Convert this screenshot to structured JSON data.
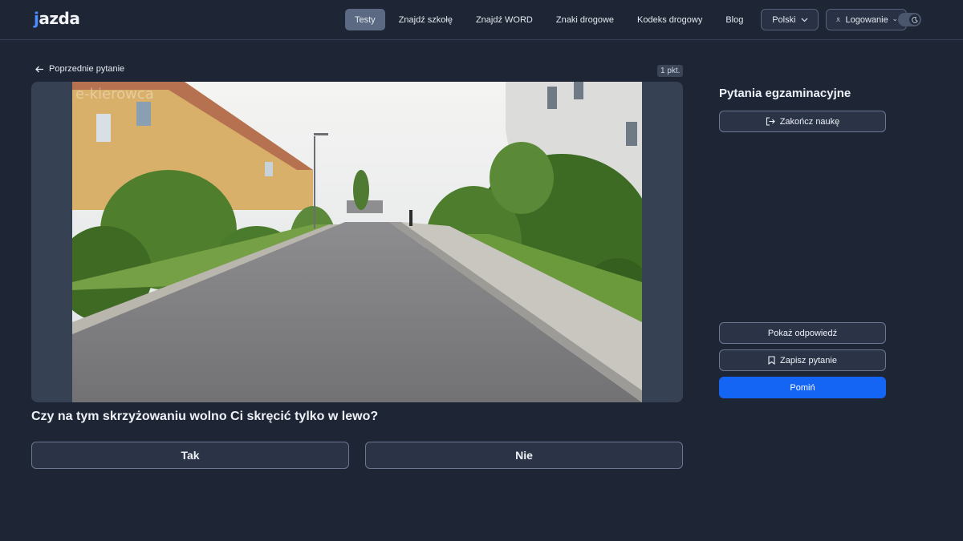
{
  "header": {
    "logo": "jazda",
    "nav": [
      {
        "label": "Testy",
        "active": true
      },
      {
        "label": "Znajdź szkołę"
      },
      {
        "label": "Znajdź WORD"
      },
      {
        "label": "Znaki drogowe"
      },
      {
        "label": "Kodeks drogowy"
      },
      {
        "label": "Blog"
      }
    ],
    "language_label": "Polski",
    "login_label": "Logowanie"
  },
  "question_area": {
    "prev_label": "Poprzednie pytanie",
    "points": "1 pkt.",
    "watermark": "e-kierowca",
    "question": "Czy na tym skrzyżowaniu wolno Ci skręcić tylko w lewo?",
    "answers": [
      "Tak",
      "Nie"
    ]
  },
  "sidebar": {
    "title": "Pytania egzaminacyjne",
    "end_label": "Zakończ naukę",
    "show_answer_label": "Pokaż odpowiedź",
    "save_label": "Zapisz pytanie",
    "skip_label": "Pomiń"
  },
  "colors": {
    "background": "#1e2636",
    "accent": "#1565f5",
    "logo_accent": "#4a8dff"
  }
}
